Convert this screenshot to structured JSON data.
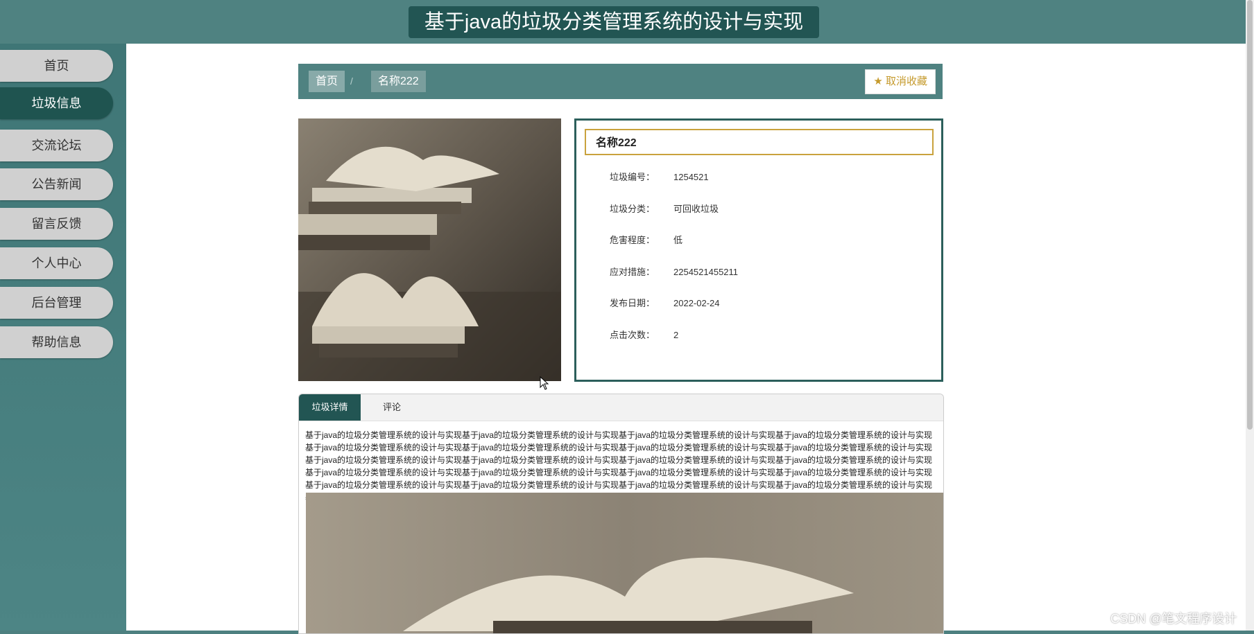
{
  "header": {
    "title": "基于java的垃圾分类管理系统的设计与实现"
  },
  "sidebar": {
    "items": [
      {
        "label": "首页"
      },
      {
        "label": "垃圾信息"
      },
      {
        "label": "交流论坛"
      },
      {
        "label": "公告新闻"
      },
      {
        "label": "留言反馈"
      },
      {
        "label": "个人中心"
      },
      {
        "label": "后台管理"
      },
      {
        "label": "帮助信息"
      }
    ],
    "active_index": 1
  },
  "breadcrumb": {
    "home": "首页",
    "separator": "/",
    "current": "名称222"
  },
  "favorite_button": {
    "label": "取消收藏",
    "icon": "star-icon"
  },
  "detail": {
    "name": "名称222",
    "fields": [
      {
        "label": "垃圾编号：",
        "value": "1254521"
      },
      {
        "label": "垃圾分类：",
        "value": "可回收垃圾"
      },
      {
        "label": "危害程度：",
        "value": "低"
      },
      {
        "label": "应对措施：",
        "value": "2254521455211"
      },
      {
        "label": "发布日期：",
        "value": "2022-02-24"
      },
      {
        "label": "点击次数：",
        "value": "2"
      }
    ]
  },
  "tabs": [
    {
      "label": "垃圾详情"
    },
    {
      "label": "评论"
    }
  ],
  "content": {
    "text": "基于java的垃圾分类管理系统的设计与实现基于java的垃圾分类管理系统的设计与实现基于java的垃圾分类管理系统的设计与实现基于java的垃圾分类管理系统的设计与实现基于java的垃圾分类管理系统的设计与实现基于java的垃圾分类管理系统的设计与实现基于java的垃圾分类管理系统的设计与实现基于java的垃圾分类管理系统的设计与实现基于java的垃圾分类管理系统的设计与实现基于java的垃圾分类管理系统的设计与实现基于java的垃圾分类管理系统的设计与实现基于java的垃圾分类管理系统的设计与实现基于java的垃圾分类管理系统的设计与实现基于java的垃圾分类管理系统的设计与实现基于java的垃圾分类管理系统的设计与实现基于java的垃圾分类管理系统的设计与实现基于java的垃圾分类管理系统的设计与实现基于java的垃圾分类管理系统的设计与实现基于java的垃圾分类管理系统的设计与实现基于java的垃圾分类管理系统的设计与实现基于java的垃圾分类管理系统的设计与实现基于java的垃圾分类管理系统的设计与实现基于java的垃圾分类管理系统的设计与实现"
  },
  "watermark": "CSDN @笔文程序设计",
  "colors": {
    "primary": "#225553",
    "header_bg": "#4f8281",
    "accent_gold": "#c9a23d"
  }
}
